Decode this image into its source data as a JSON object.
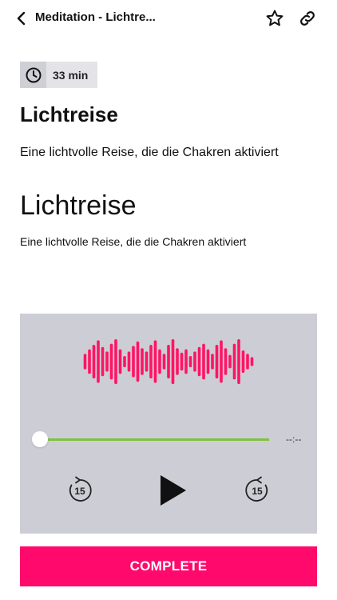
{
  "header": {
    "title": "Meditation - Lichtre...",
    "back_icon": "chevron-left-icon",
    "favorite_icon": "star-outline-icon",
    "share_icon": "link-icon"
  },
  "duration": {
    "icon": "clock-icon",
    "label": "33 min"
  },
  "content": {
    "heading": "Lichtreise",
    "subtitle": "Eine lichtvolle Reise, die die Chakren aktiviert",
    "heading_large": "Lichtreise",
    "subtitle_small": "Eine lichtvolle Reise, die die Chakren aktiviert"
  },
  "player": {
    "waveform_color": "#ff1464",
    "waveform_levels": [
      0.35,
      0.55,
      0.75,
      0.95,
      0.65,
      0.45,
      0.8,
      1.0,
      0.55,
      0.25,
      0.45,
      0.7,
      0.9,
      0.6,
      0.45,
      0.75,
      0.95,
      0.55,
      0.35,
      0.75,
      1.0,
      0.6,
      0.4,
      0.55,
      0.25,
      0.45,
      0.65,
      0.8,
      0.55,
      0.35,
      0.75,
      0.95,
      0.6,
      0.3,
      0.8,
      1.0,
      0.5,
      0.35,
      0.2
    ],
    "progress": 0,
    "track_color": "#7fc341",
    "time": "--:--",
    "rewind_seconds": "15",
    "forward_seconds": "15",
    "rewind_icon": "rewind-15-icon",
    "play_icon": "play-icon",
    "forward_icon": "forward-15-icon"
  },
  "complete_button": {
    "label": "COMPLETE",
    "color": "#ff0a6c"
  }
}
